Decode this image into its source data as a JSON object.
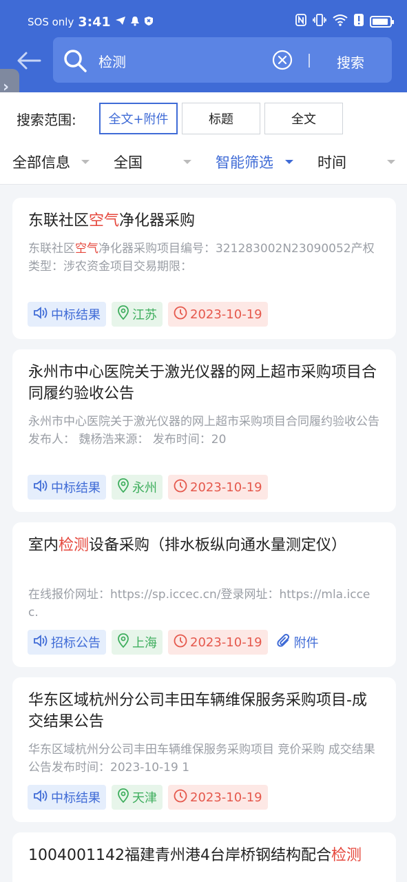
{
  "status": {
    "carrier": "SOS only",
    "time": "3:41"
  },
  "search": {
    "query": "检测",
    "button": "搜索"
  },
  "scope": {
    "label": "搜索范围:",
    "options": [
      "全文+附件",
      "标题",
      "全文"
    ]
  },
  "filters": [
    "全部信息",
    "全国",
    "智能筛选",
    "时间"
  ],
  "cards": [
    {
      "title": [
        "东联社区",
        "空气",
        "净化器采购"
      ],
      "desc": [
        "东联社区",
        "空气",
        "净化器采购项目编号：321283002N23090052产权类型：涉农资金项目交易期限："
      ],
      "type": "中标结果",
      "location": "江苏",
      "date": "2023-10-19"
    },
    {
      "title": [
        "永州市中心医院关于激光仪器的网上超市采购项目合同履约验收公告"
      ],
      "desc": [
        "永州市中心医院关于激光仪器的网上超市采购项目合同履约验收公告发布人： 魏杨浩来源： 发布时间：20"
      ],
      "type": "中标结果",
      "location": "永州",
      "date": "2023-10-19"
    },
    {
      "title": [
        "室内",
        "检测",
        "设备采购（排水板纵向通水量测定仪）"
      ],
      "desc": [
        "在线报价网址：https://sp.iccec.cn/登录网址：https://mla.iccec."
      ],
      "type": "招标公告",
      "location": "上海",
      "date": "2023-10-19",
      "attachment": "附件"
    },
    {
      "title": [
        "华东区域杭州分公司丰田车辆维保服务采购项目-成交结果公告"
      ],
      "desc": [
        "华东区域杭州分公司丰田车辆维保服务采购项目 竞价采购 成交结果公告发布时间：2023-10-19 1"
      ],
      "type": "中标结果",
      "location": "天津",
      "date": "2023-10-19"
    },
    {
      "title": [
        "1004001142福建青州港4台岸桥钢结构配合",
        "检测"
      ]
    }
  ]
}
